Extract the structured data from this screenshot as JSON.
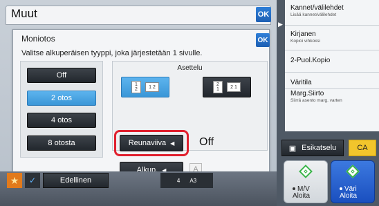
{
  "outer": {
    "title": "Muut",
    "ok": "OK"
  },
  "inner": {
    "title": "Moniotos",
    "ok": "OK",
    "instruction": "Valitse alkuperäisen tyyppi, joka järjestetään 1 sivulle.",
    "options": [
      "Off",
      "2 otos",
      "4 otos",
      "8 otosta"
    ],
    "selected_option": "2 otos",
    "layout_label": "Asettelu",
    "layout_left": {
      "top": "1",
      "bottom": "2",
      "row": "1 2"
    },
    "layout_right": {
      "top": "2",
      "bottom": "1",
      "row": "2 1"
    },
    "border_button": "Reunaviiva",
    "border_value": "Off",
    "original_button": "Alkup.",
    "a_button": "A"
  },
  "bottom": {
    "prev_label": "Edellinen",
    "paper_count": "4",
    "paper_size": "A3"
  },
  "sidebar": {
    "items": [
      {
        "label": "Kannet/välilehdet",
        "sub": "Lisää kannet/välilehdet"
      },
      {
        "label": "Kirjanen",
        "sub": "Kopioi vihkoksi"
      },
      {
        "label": "2-Puol.Kopio",
        "sub": ""
      },
      {
        "label": "Väritila",
        "sub": ""
      },
      {
        "label": "Marg.Siirto",
        "sub": "Siirrä asento marg. varten"
      }
    ],
    "preview": "Esikatselu",
    "ca": "CA",
    "start_mv": {
      "line1": "M/V",
      "line2": "Aloita"
    },
    "start_color": {
      "line1": "Väri",
      "line2": "Aloita"
    }
  },
  "colors": {
    "accent_blue": "#3a96d7",
    "highlight_red": "#e0202e",
    "ca_yellow": "#f2c52c",
    "start_blue": "#1a4fbf"
  }
}
